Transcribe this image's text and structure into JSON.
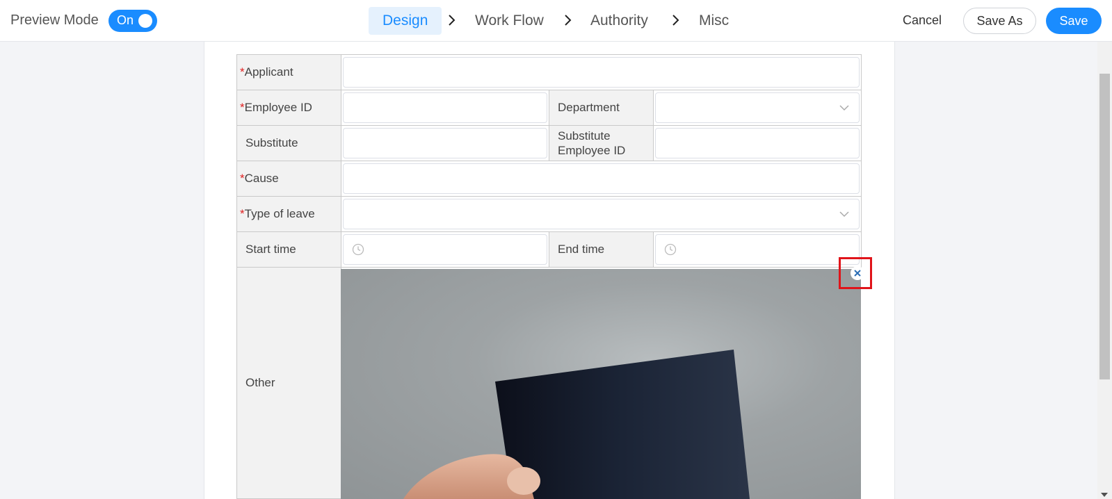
{
  "header": {
    "preview_label": "Preview Mode",
    "toggle_label": "On",
    "steps": [
      "Design",
      "Work Flow",
      "Authority",
      "Misc"
    ],
    "cancel_label": "Cancel",
    "save_as_label": "Save As",
    "save_label": "Save"
  },
  "form": {
    "required_marker": "*",
    "fields": {
      "applicant": "Applicant",
      "employee_id": "Employee ID",
      "department": "Department",
      "substitute": "Substitute",
      "substitute_employee_id": "Substitute Employee ID",
      "cause": "Cause",
      "type_of_leave": "Type of leave",
      "start_time": "Start time",
      "end_time": "End time",
      "other": "Other"
    }
  },
  "colors": {
    "accent": "#1a8cff",
    "required": "#e02020",
    "highlight": "#e0141a"
  }
}
